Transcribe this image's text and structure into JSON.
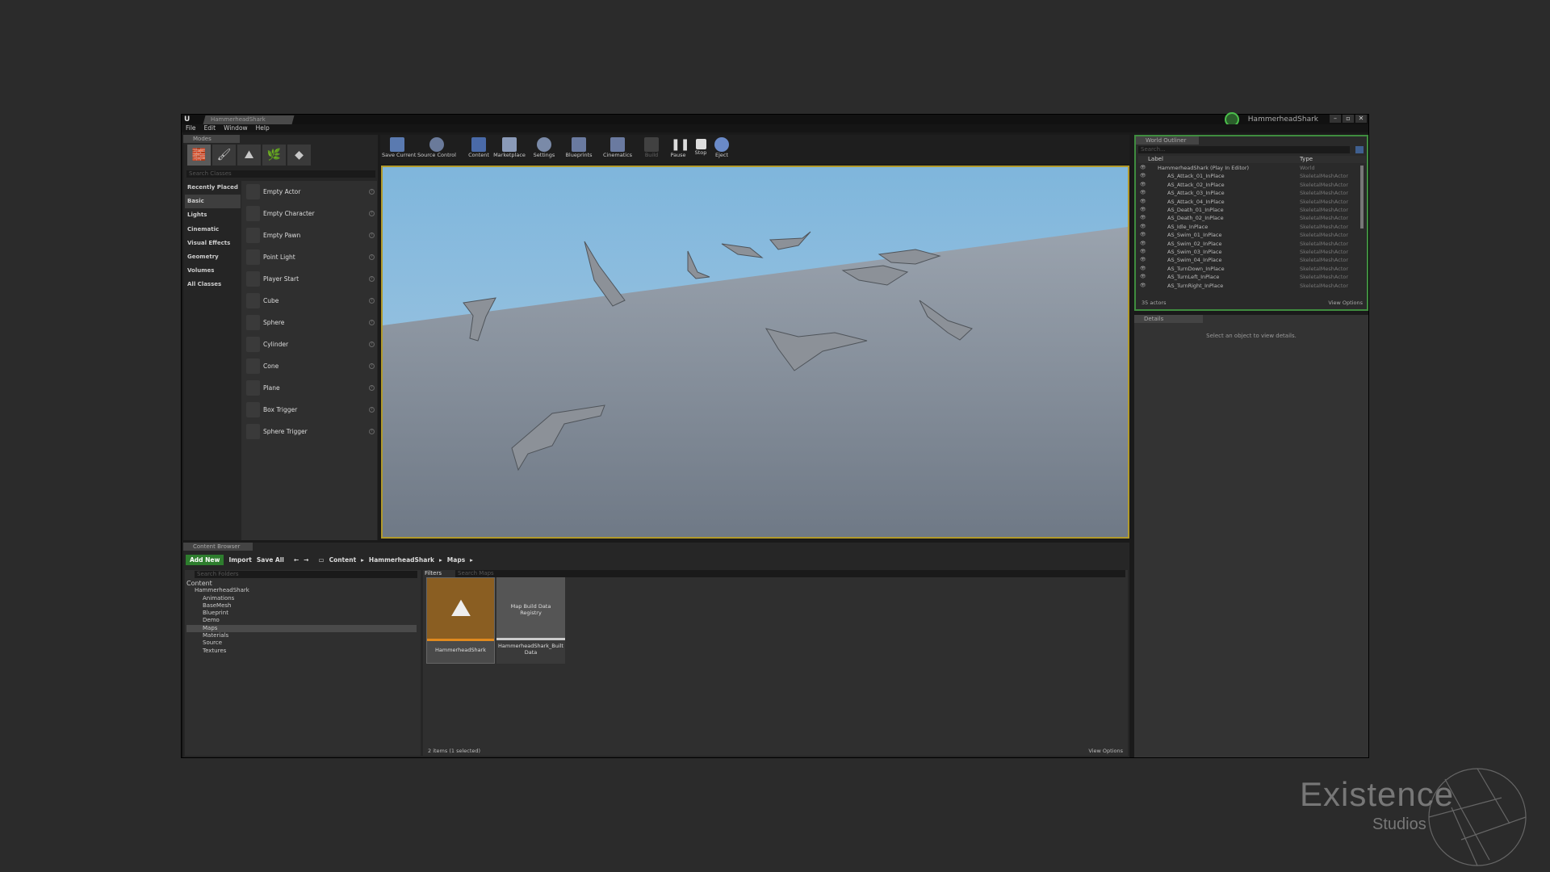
{
  "window": {
    "doc_tab": "HammerheadShark",
    "project_name": "HammerheadShark",
    "controls": [
      "–",
      "▫",
      "✕"
    ]
  },
  "menu": [
    "File",
    "Edit",
    "Window",
    "Help"
  ],
  "modes": {
    "tab": "Modes",
    "search_placeholder": "Search Classes",
    "categories": [
      "Recently Placed",
      "Basic",
      "Lights",
      "Cinematic",
      "Visual Effects",
      "Geometry",
      "Volumes",
      "All Classes"
    ],
    "items": [
      "Empty Actor",
      "Empty Character",
      "Empty Pawn",
      "Point Light",
      "Player Start",
      "Cube",
      "Sphere",
      "Cylinder",
      "Cone",
      "Plane",
      "Box Trigger",
      "Sphere Trigger"
    ]
  },
  "toolbar": [
    "Save Current",
    "Source Control",
    "Content",
    "Marketplace",
    "Settings",
    "Blueprints",
    "Cinematics",
    "Build",
    "Pause",
    "Stop",
    "Eject"
  ],
  "outliner": {
    "tab": "World Outliner",
    "search_placeholder": "Search...",
    "col_label": "Label",
    "col_type": "Type",
    "rows": [
      {
        "name": "HammerheadShark (Play In Editor)",
        "type": "World"
      },
      {
        "name": "AS_Attack_01_InPlace",
        "type": "SkeletalMeshActor"
      },
      {
        "name": "AS_Attack_02_InPlace",
        "type": "SkeletalMeshActor"
      },
      {
        "name": "AS_Attack_03_InPlace",
        "type": "SkeletalMeshActor"
      },
      {
        "name": "AS_Attack_04_InPlace",
        "type": "SkeletalMeshActor"
      },
      {
        "name": "AS_Death_01_InPlace",
        "type": "SkeletalMeshActor"
      },
      {
        "name": "AS_Death_02_InPlace",
        "type": "SkeletalMeshActor"
      },
      {
        "name": "AS_Idle_InPlace",
        "type": "SkeletalMeshActor"
      },
      {
        "name": "AS_Swim_01_InPlace",
        "type": "SkeletalMeshActor"
      },
      {
        "name": "AS_Swim_02_InPlace",
        "type": "SkeletalMeshActor"
      },
      {
        "name": "AS_Swim_03_InPlace",
        "type": "SkeletalMeshActor"
      },
      {
        "name": "AS_Swim_04_InPlace",
        "type": "SkeletalMeshActor"
      },
      {
        "name": "AS_TurnDown_InPlace",
        "type": "SkeletalMeshActor"
      },
      {
        "name": "AS_TurnLeft_InPlace",
        "type": "SkeletalMeshActor"
      },
      {
        "name": "AS_TurnRight_InPlace",
        "type": "SkeletalMeshActor"
      }
    ],
    "actor_count": "35 actors",
    "view_options": "View Options"
  },
  "details": {
    "tab": "Details",
    "empty_text": "Select an object to view details."
  },
  "content_browser": {
    "tab": "Content Browser",
    "add_new": "Add New",
    "import": "Import",
    "save_all": "Save All",
    "path": [
      "Content",
      "HammerheadShark",
      "Maps"
    ],
    "search_folders": "Search Folders",
    "filters": "Filters",
    "search_assets": "Search Maps",
    "tree": [
      "Content",
      "HammerheadShark",
      "Animations",
      "BaseMesh",
      "Blueprint",
      "Demo",
      "Maps",
      "Materials",
      "Source",
      "Textures"
    ],
    "assets": [
      {
        "name": "HammerheadShark",
        "thumb": ""
      },
      {
        "name": "HammerheadShark_BuiltData",
        "thumb": "Map Build Data Registry"
      }
    ],
    "status": "2 items (1 selected)",
    "view_options": "View Options"
  },
  "watermark": {
    "line1": "Existence",
    "line2": "Studios"
  },
  "colors": {
    "accent_green": "#2e7d2e",
    "viewport_border": "#b19a2c",
    "selected_asset": "#e08a1e"
  }
}
